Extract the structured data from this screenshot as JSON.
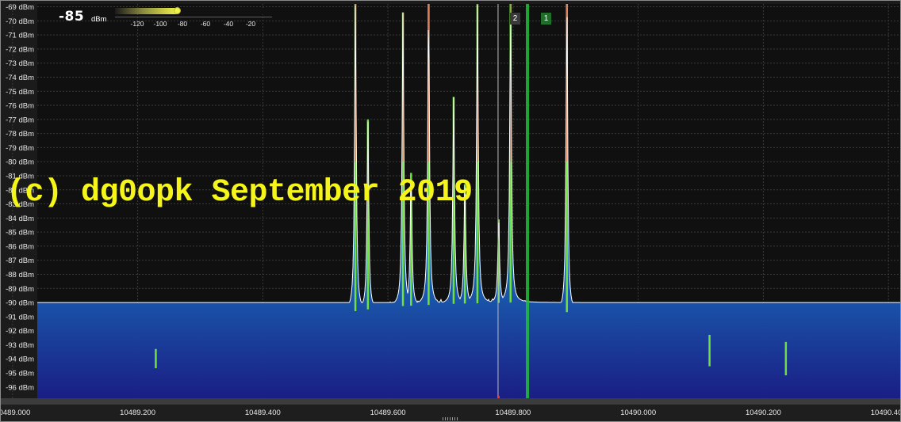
{
  "level": {
    "value": "-85",
    "unit": "dBm"
  },
  "gauge": {
    "ticks": [
      "-120",
      "-100",
      "-80",
      "-60",
      "-40",
      "-20"
    ],
    "level_fraction": 0.4
  },
  "watermark": "(c) dg0opk September 2019",
  "markers": [
    {
      "label": "1",
      "color": "#22c03a"
    },
    {
      "label": "2",
      "color": "#bbbbbb"
    }
  ],
  "colors": {
    "trace": "#ffffff",
    "fill_top": "#19c2b4",
    "fill_bottom": "#1a1f8a",
    "peak_green": "#6fe040",
    "peak_red": "#ff6060",
    "watermark": "#f5f51a"
  },
  "chart_data": {
    "type": "area",
    "title": "",
    "xlabel": "",
    "ylabel": "",
    "y_unit": "dBm",
    "ylim": [
      -96.8,
      -68.8
    ],
    "xlim": [
      10488.98,
      10490.42
    ],
    "y_ticks": [
      "-69 dBm",
      "-70 dBm",
      "-71 dBm",
      "-72 dBm",
      "-73 dBm",
      "-74 dBm",
      "-75 dBm",
      "-76 dBm",
      "-77 dBm",
      "-78 dBm",
      "-79 dBm",
      "-80 dBm",
      "-81 dBm",
      "-82 dBm",
      "-83 dBm",
      "-84 dBm",
      "-85 dBm",
      "-86 dBm",
      "-87 dBm",
      "-88 dBm",
      "-89 dBm",
      "-90 dBm",
      "-91 dBm",
      "-92 dBm",
      "-93 dBm",
      "-94 dBm",
      "-95 dBm",
      "-96 dBm"
    ],
    "x_ticks": [
      "10489.000",
      "10489.200",
      "10489.400",
      "10489.600",
      "10489.800",
      "10490.000",
      "10490.200",
      "10490.400"
    ],
    "grid": true,
    "noise_floor": {
      "x": [
        10488.98,
        10489.1,
        10489.25,
        10489.35,
        10489.42,
        10489.5,
        10489.6,
        10489.7,
        10489.8,
        10489.88,
        10489.95,
        10490.05,
        10490.15,
        10490.25,
        10490.35,
        10490.42
      ],
      "y": [
        -96.2,
        -95.1,
        -94.6,
        -93.6,
        -92.4,
        -90.9,
        -90.3,
        -90.1,
        -90.0,
        -90.6,
        -91.6,
        -93.7,
        -95.0,
        -95.2,
        -95.6,
        -95.7
      ]
    },
    "peaks": [
      {
        "x": 10489.548,
        "y": -68.8
      },
      {
        "x": 10489.568,
        "y": -77.0
      },
      {
        "x": 10489.624,
        "y": -69.4
      },
      {
        "x": 10489.637,
        "y": -80.8
      },
      {
        "x": 10489.665,
        "y": -68.8
      },
      {
        "x": 10489.705,
        "y": -75.4
      },
      {
        "x": 10489.723,
        "y": -81.6
      },
      {
        "x": 10489.743,
        "y": -68.8
      },
      {
        "x": 10489.777,
        "y": -84.1
      },
      {
        "x": 10489.796,
        "y": -68.8
      },
      {
        "x": 10489.886,
        "y": -68.8
      },
      {
        "x": 10489.229,
        "y": -93.3
      },
      {
        "x": 10490.114,
        "y": -92.3
      },
      {
        "x": 10490.236,
        "y": -92.8
      }
    ],
    "markers_x": {
      "1": 10489.823,
      "2": 10489.776
    }
  }
}
